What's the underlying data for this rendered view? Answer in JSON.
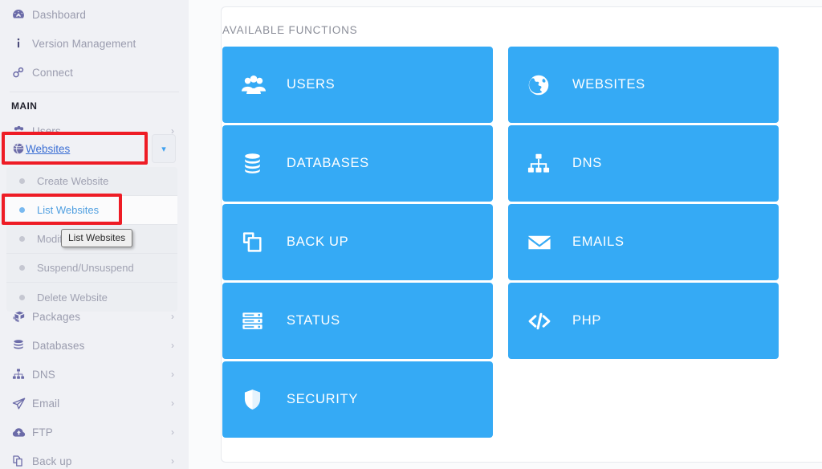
{
  "sidebar": {
    "top_items": [
      {
        "label": "Dashboard",
        "icon": "dashboard-gauge-icon",
        "has_chevron": false
      },
      {
        "label": "Version Management",
        "icon": "info-icon",
        "has_chevron": false
      },
      {
        "label": "Connect",
        "icon": "link-chain-icon",
        "has_chevron": false
      }
    ],
    "section_label": "MAIN",
    "main_items": [
      {
        "label": "Users",
        "icon": "users-group-icon",
        "has_chevron": true
      }
    ],
    "active_item": {
      "label": "Websites",
      "icon": "globe-icon",
      "expanded": true
    },
    "submenu": [
      {
        "label": "Create Website",
        "active": false
      },
      {
        "label": "List Websites",
        "active": true
      },
      {
        "label": "Modify Website",
        "active": false
      },
      {
        "label": "Suspend/Unsuspend",
        "active": false
      },
      {
        "label": "Delete Website",
        "active": false
      }
    ],
    "tooltip": "List Websites",
    "bottom_items": [
      {
        "label": "Packages",
        "icon": "packages-boxes-icon",
        "has_chevron": true
      },
      {
        "label": "Databases",
        "icon": "database-icon",
        "has_chevron": true
      },
      {
        "label": "DNS",
        "icon": "sitemap-icon",
        "has_chevron": true
      },
      {
        "label": "Email",
        "icon": "paper-plane-icon",
        "has_chevron": true
      },
      {
        "label": "FTP",
        "icon": "cloud-upload-icon",
        "has_chevron": true
      },
      {
        "label": "Back up",
        "icon": "copy-files-icon",
        "has_chevron": true
      }
    ]
  },
  "main": {
    "card_title": "AVAILABLE FUNCTIONS",
    "tiles_left": [
      {
        "label": "USERS",
        "icon": "users-group-icon"
      },
      {
        "label": "DATABASES",
        "icon": "database-icon"
      },
      {
        "label": "BACK UP",
        "icon": "copy-files-icon"
      },
      {
        "label": "STATUS",
        "icon": "server-rack-icon"
      },
      {
        "label": "SECURITY",
        "icon": "shield-icon"
      }
    ],
    "tiles_right": [
      {
        "label": "WEBSITES",
        "icon": "globe-icon"
      },
      {
        "label": "DNS",
        "icon": "sitemap-icon"
      },
      {
        "label": "EMAILS",
        "icon": "envelope-icon"
      },
      {
        "label": "PHP",
        "icon": "code-brackets-icon"
      }
    ]
  },
  "colors": {
    "tile_blue": "#35aaf5",
    "annotation_red": "#ee1c25",
    "sidebar_bg": "#f0f1f5",
    "active_link_blue": "#3b6fd4",
    "submenu_active_blue": "#4f9fe0"
  }
}
